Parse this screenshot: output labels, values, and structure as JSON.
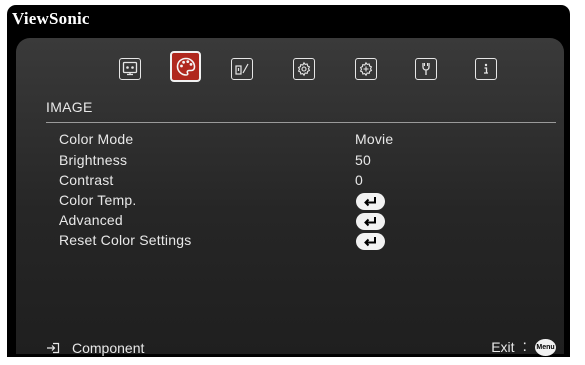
{
  "brand": "ViewSonic",
  "tabs": [
    {
      "name": "display-icon"
    },
    {
      "name": "image-palette-icon"
    },
    {
      "name": "power-management-icon"
    },
    {
      "name": "basic-settings-icon"
    },
    {
      "name": "advanced-settings-icon"
    },
    {
      "name": "system-tools-icon"
    },
    {
      "name": "information-icon"
    }
  ],
  "section": {
    "title": "IMAGE"
  },
  "rows": [
    {
      "label": "Color Mode",
      "value": "Movie"
    },
    {
      "label": "Brightness",
      "value": "50"
    },
    {
      "label": "Contrast",
      "value": "0"
    },
    {
      "label": "Color Temp.",
      "value_icon": "enter-icon"
    },
    {
      "label": "Advanced",
      "value_icon": "enter-icon"
    },
    {
      "label": "Reset Color Settings",
      "value_icon": "enter-icon"
    }
  ],
  "footer": {
    "source_icon": "input-source-icon",
    "source": "Component",
    "exit_label": "Exit",
    "colon": ":",
    "menu_button": "Menu"
  },
  "colors": {
    "active_tab": "#b0281e",
    "panel": "#2a2a2a",
    "frame": "#000000"
  }
}
